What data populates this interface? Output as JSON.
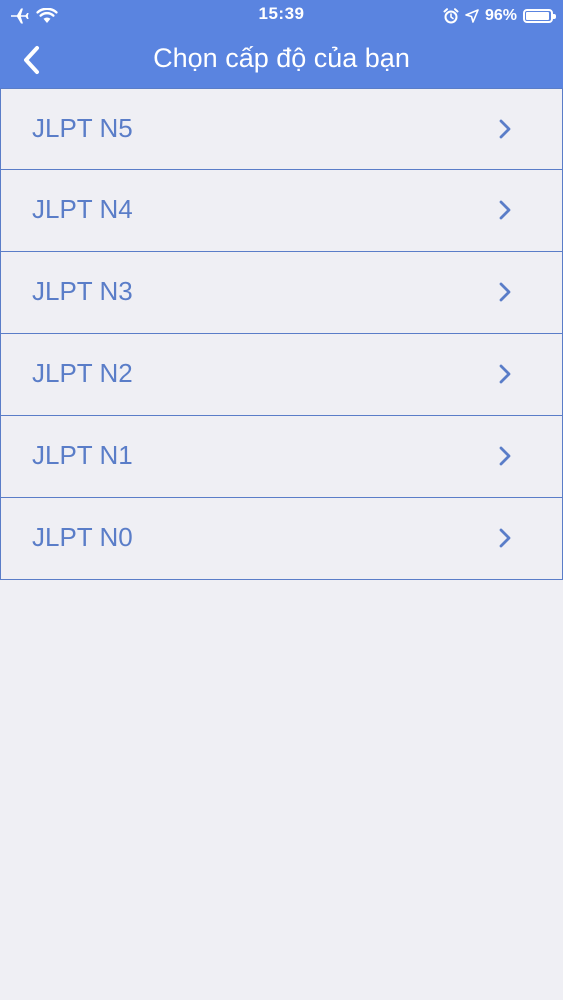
{
  "status_bar": {
    "time": "15:39",
    "battery_percent": "96%",
    "battery_level": 0.96,
    "left_icons": [
      "airplane-icon",
      "wifi-icon"
    ],
    "right_icons": [
      "alarm-icon",
      "location-icon",
      "battery-icon"
    ]
  },
  "nav": {
    "title": "Chọn cấp độ của bạn",
    "back_icon": "chevron-left-icon"
  },
  "levels": [
    {
      "label": "JLPT N5"
    },
    {
      "label": "JLPT N4"
    },
    {
      "label": "JLPT N3"
    },
    {
      "label": "JLPT N2"
    },
    {
      "label": "JLPT N1"
    },
    {
      "label": "JLPT N0"
    }
  ],
  "colors": {
    "header_bg": "#5a84e0",
    "accent": "#5a7dc8",
    "page_bg": "#efeff4"
  }
}
